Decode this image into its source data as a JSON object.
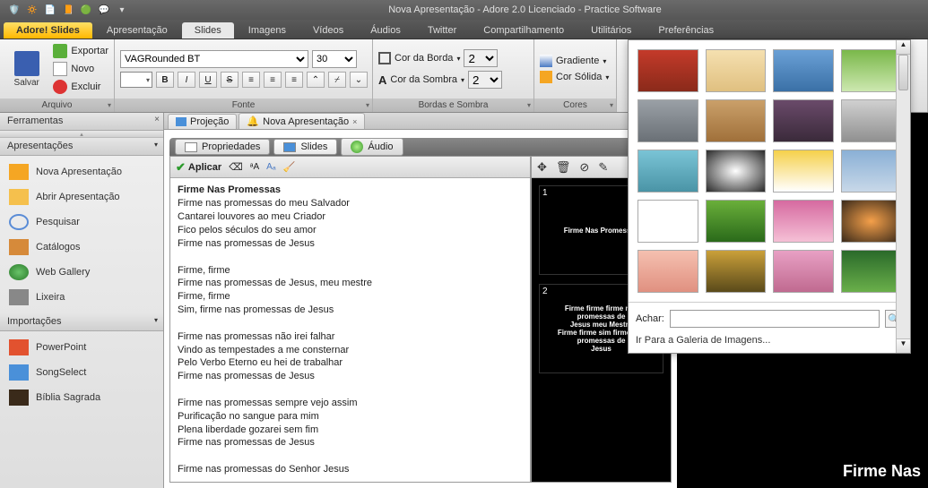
{
  "window": {
    "title": "Nova Apresentação - Adore 2.0 Licenciado - Practice Software"
  },
  "tabs": {
    "primary": "Adore! Slides",
    "items": [
      "Apresentação",
      "Slides",
      "Imagens",
      "Vídeos",
      "Áudios",
      "Twitter",
      "Compartilhamento",
      "Utilitários",
      "Preferências"
    ],
    "active": "Slides"
  },
  "ribbon": {
    "arquivo": {
      "label": "Arquivo",
      "save": "Salvar",
      "export": "Exportar",
      "new": "Novo",
      "delete": "Excluir"
    },
    "fonte": {
      "label": "Fonte",
      "font_name": "VAGRounded BT",
      "font_size": "30",
      "bold": "B",
      "italic": "I",
      "underline": "U",
      "strike": "S"
    },
    "bordas": {
      "label": "Bordas e Sombra",
      "cor_borda": "Cor da Borda",
      "cor_borda_val": "2",
      "cor_sombra": "Cor da Sombra",
      "cor_sombra_val": "2"
    },
    "cores": {
      "label": "Cores",
      "gradiente": "Gradiente",
      "solida": "Cor Sólida"
    }
  },
  "left": {
    "ferramentas": "Ferramentas",
    "apres_title": "Apresentações",
    "apres_items": [
      "Nova Apresentação",
      "Abrir Apresentação",
      "Pesquisar",
      "Catálogos",
      "Web Gallery",
      "Lixeira"
    ],
    "import_title": "Importações",
    "import_items": [
      "PowerPoint",
      "SongSelect",
      "Bíblia Sagrada"
    ]
  },
  "doc_tabs": {
    "projecao": "Projeção",
    "nova": "Nova Apresentação"
  },
  "sub_tabs": {
    "prop": "Propriedades",
    "slides": "Slides",
    "audio": "Áudio"
  },
  "editor_toolbar": {
    "aplicar": "Aplicar"
  },
  "lyrics": {
    "title": "Firme Nas Promessas",
    "body": "Firme nas promessas do meu Salvador\nCantarei louvores ao meu Criador\nFico pelos séculos do seu amor\nFirme nas promessas de Jesus\n\nFirme, firme\nFirme nas promessas de Jesus, meu mestre\nFirme, firme\nSim, firme nas promessas de Jesus\n\nFirme nas promessas não irei falhar\nVindo as tempestades a me consternar\nPelo Verbo Eterno eu hei de trabalhar\nFirme nas promessas de Jesus\n\nFirme nas promessas sempre vejo assim\nPurificação no sangue para mim\nPlena liberdade gozarei sem fim\nFirme nas promessas de Jesus\n\nFirme nas promessas do Senhor Jesus"
  },
  "thumbs": {
    "s1": {
      "num": "1",
      "text": "Firme Nas Promessas"
    },
    "s2": {
      "num": "2",
      "text": "Firme firme firme nas promessas de\nJesus meu Mestre\nFirme firme sim firme nas promessas de\nJesus"
    }
  },
  "gallery": {
    "achar": "Achar:",
    "link": "Ir Para a Galeria de Imagens...",
    "swatches": [
      "#c43a2a",
      "#f5e0b0",
      "#6aa0d6",
      "#7ab84a",
      "#9aa0a6",
      "#caa06a",
      "#6a4a6a",
      "#d0d0d0",
      "#7ac4d6",
      "#2a2a2a",
      "#f5d04a",
      "#8ab0d6",
      "#ffffff",
      "#6aaf3a",
      "#d66aa0",
      "#3a2a1a",
      "#f5c0b0",
      "#caa03a",
      "#e8a0c4",
      "#2a6a2a"
    ]
  },
  "preview": {
    "text": "Firme Nas"
  }
}
